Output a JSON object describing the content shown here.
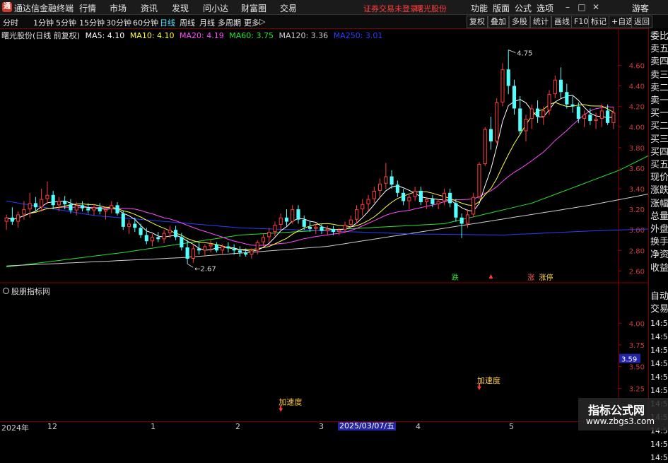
{
  "title_bar": {
    "app_name": "通达信金融终端",
    "menus": [
      "行情",
      "市场",
      "资讯",
      "发现",
      "问小达",
      "财富圈",
      "交易"
    ],
    "notice": "证券交易未登录",
    "stock_name": "曙光股份",
    "right_menus": [
      "功能",
      "版面",
      "公式",
      "选项"
    ],
    "guest": "游客",
    "win_min": "–",
    "win_max": "□",
    "win_close": "✕"
  },
  "toolbar": {
    "periods": [
      "分时",
      "1分钟",
      "5分钟",
      "15分钟",
      "30分钟",
      "60分钟",
      "日线",
      "周线",
      "月线",
      "多周期",
      "更多"
    ],
    "active_period": "日线",
    "more_arrow": "▷",
    "buttons": [
      "复权",
      "叠加",
      "多股",
      "统计",
      "画线",
      "F10",
      "标记",
      "+自选",
      "返回"
    ]
  },
  "chart_header": {
    "stock_label": "曙光股份(日线 前复权)",
    "ma": [
      {
        "label": "MA5: 4.10",
        "color": "#ffffff"
      },
      {
        "label": "MA10: 4.10",
        "color": "#ffff3a"
      },
      {
        "label": "MA20: 4.19",
        "color": "#ff4cff"
      },
      {
        "label": "MA60: 3.75",
        "color": "#29e22d"
      },
      {
        "label": "MA120: 3.36",
        "color": "#cfcfcf"
      },
      {
        "label": "MA250: 3.01",
        "color": "#2c3cff"
      }
    ]
  },
  "colors": {
    "up": "#ff3d3d",
    "down": "#54ffff",
    "ma5": "#ffffff",
    "ma10": "#ffff3a",
    "ma20": "#ff4cff",
    "ma60": "#29e22d",
    "ma120": "#cfcfcf",
    "ma250": "#2c3cff",
    "axis": "#8b0000",
    "grid": "#5a0000"
  },
  "annotations": {
    "high_label": "4.75",
    "low_label": "2.67",
    "signal_die": "跌",
    "signal_zhang": "涨",
    "signal_zhangting": "涨停"
  },
  "indicator": {
    "title": "股朋指标网",
    "signal_text": "加速度",
    "current_value_label": "3.59"
  },
  "right_panel": {
    "items": [
      "委比",
      "卖五",
      "卖四",
      "卖三",
      "卖二",
      "卖一",
      "买一",
      "买二",
      "买三",
      "买四",
      "买五",
      "现价",
      "涨跌",
      "涨幅",
      "总量",
      "外盘",
      "换手",
      "净资",
      "收益"
    ],
    "auto": "自动",
    "trade": "交易",
    "times": [
      "14:56",
      "14:56",
      "14:56",
      "14:56",
      "14:56",
      "14:56",
      "14:56",
      "14:56",
      "14:56",
      "14:56",
      "14:56"
    ]
  },
  "time_axis": {
    "labels": [
      "2024年",
      "12",
      "1",
      "2",
      "3",
      "2025/03/07/五",
      "4",
      "5"
    ]
  },
  "watermark": {
    "line1": "指标公式网",
    "line2": "www.zbgs3.com"
  },
  "chart_data": [
    {
      "type": "candlestick",
      "title": "曙光股份(日线 前复权)",
      "ylim": [
        2.5,
        4.85
      ],
      "y_ticks": [
        2.6,
        2.8,
        3.0,
        3.2,
        3.4,
        3.6,
        3.8,
        4.0,
        4.2,
        4.4,
        4.6
      ],
      "candles": [
        {
          "o": 3.08,
          "h": 3.15,
          "l": 3.0,
          "c": 3.12
        },
        {
          "o": 3.12,
          "h": 3.22,
          "l": 3.05,
          "c": 3.08
        },
        {
          "o": 3.08,
          "h": 3.18,
          "l": 3.02,
          "c": 3.15
        },
        {
          "o": 3.15,
          "h": 3.28,
          "l": 3.1,
          "c": 3.2
        },
        {
          "o": 3.2,
          "h": 3.36,
          "l": 3.12,
          "c": 3.26
        },
        {
          "o": 3.26,
          "h": 3.32,
          "l": 3.18,
          "c": 3.22
        },
        {
          "o": 3.22,
          "h": 3.4,
          "l": 3.18,
          "c": 3.3
        },
        {
          "o": 3.3,
          "h": 3.47,
          "l": 3.25,
          "c": 3.34
        },
        {
          "o": 3.34,
          "h": 3.38,
          "l": 3.2,
          "c": 3.24
        },
        {
          "o": 3.24,
          "h": 3.32,
          "l": 3.18,
          "c": 3.28
        },
        {
          "o": 3.28,
          "h": 3.33,
          "l": 3.2,
          "c": 3.25
        },
        {
          "o": 3.25,
          "h": 3.3,
          "l": 3.16,
          "c": 3.19
        },
        {
          "o": 3.19,
          "h": 3.27,
          "l": 3.14,
          "c": 3.24
        },
        {
          "o": 3.24,
          "h": 3.28,
          "l": 3.18,
          "c": 3.21
        },
        {
          "o": 3.21,
          "h": 3.26,
          "l": 3.16,
          "c": 3.19
        },
        {
          "o": 3.19,
          "h": 3.25,
          "l": 3.14,
          "c": 3.22
        },
        {
          "o": 3.22,
          "h": 3.26,
          "l": 3.15,
          "c": 3.18
        },
        {
          "o": 3.18,
          "h": 3.22,
          "l": 3.1,
          "c": 3.2
        },
        {
          "o": 3.2,
          "h": 3.28,
          "l": 3.16,
          "c": 3.24
        },
        {
          "o": 3.24,
          "h": 3.27,
          "l": 3.14,
          "c": 3.16
        },
        {
          "o": 3.16,
          "h": 3.19,
          "l": 3.0,
          "c": 3.03
        },
        {
          "o": 3.03,
          "h": 3.1,
          "l": 2.96,
          "c": 3.06
        },
        {
          "o": 3.06,
          "h": 3.12,
          "l": 2.98,
          "c": 3.02
        },
        {
          "o": 3.02,
          "h": 3.06,
          "l": 2.92,
          "c": 2.95
        },
        {
          "o": 2.95,
          "h": 3.02,
          "l": 2.86,
          "c": 2.89
        },
        {
          "o": 2.89,
          "h": 2.96,
          "l": 2.84,
          "c": 2.93
        },
        {
          "o": 2.93,
          "h": 2.98,
          "l": 2.88,
          "c": 2.91
        },
        {
          "o": 2.91,
          "h": 3.0,
          "l": 2.87,
          "c": 2.97
        },
        {
          "o": 2.97,
          "h": 3.04,
          "l": 2.92,
          "c": 3.0
        },
        {
          "o": 3.0,
          "h": 3.04,
          "l": 2.9,
          "c": 2.93
        },
        {
          "o": 2.93,
          "h": 2.97,
          "l": 2.8,
          "c": 2.83
        },
        {
          "o": 2.83,
          "h": 2.9,
          "l": 2.67,
          "c": 2.72
        },
        {
          "o": 2.72,
          "h": 2.86,
          "l": 2.68,
          "c": 2.82
        },
        {
          "o": 2.82,
          "h": 2.88,
          "l": 2.76,
          "c": 2.8
        },
        {
          "o": 2.8,
          "h": 2.86,
          "l": 2.74,
          "c": 2.84
        },
        {
          "o": 2.84,
          "h": 2.9,
          "l": 2.78,
          "c": 2.86
        },
        {
          "o": 2.86,
          "h": 2.88,
          "l": 2.78,
          "c": 2.8
        },
        {
          "o": 2.8,
          "h": 2.86,
          "l": 2.76,
          "c": 2.84
        },
        {
          "o": 2.84,
          "h": 2.88,
          "l": 2.78,
          "c": 2.82
        },
        {
          "o": 2.82,
          "h": 2.86,
          "l": 2.76,
          "c": 2.8
        },
        {
          "o": 2.8,
          "h": 2.84,
          "l": 2.74,
          "c": 2.78
        },
        {
          "o": 2.78,
          "h": 2.82,
          "l": 2.74,
          "c": 2.76
        },
        {
          "o": 2.76,
          "h": 2.82,
          "l": 2.72,
          "c": 2.8
        },
        {
          "o": 2.8,
          "h": 2.9,
          "l": 2.76,
          "c": 2.88
        },
        {
          "o": 2.88,
          "h": 2.96,
          "l": 2.84,
          "c": 2.93
        },
        {
          "o": 2.93,
          "h": 3.02,
          "l": 2.88,
          "c": 2.98
        },
        {
          "o": 2.98,
          "h": 3.08,
          "l": 2.94,
          "c": 3.05
        },
        {
          "o": 3.05,
          "h": 3.16,
          "l": 3.0,
          "c": 3.12
        },
        {
          "o": 3.12,
          "h": 3.2,
          "l": 3.04,
          "c": 3.08
        },
        {
          "o": 3.08,
          "h": 3.24,
          "l": 3.06,
          "c": 3.2
        },
        {
          "o": 3.2,
          "h": 3.24,
          "l": 3.06,
          "c": 3.1
        },
        {
          "o": 3.1,
          "h": 3.14,
          "l": 3.0,
          "c": 3.03
        },
        {
          "o": 3.03,
          "h": 3.08,
          "l": 2.98,
          "c": 3.01
        },
        {
          "o": 3.01,
          "h": 3.06,
          "l": 2.96,
          "c": 3.03
        },
        {
          "o": 3.03,
          "h": 3.06,
          "l": 2.96,
          "c": 2.99
        },
        {
          "o": 2.99,
          "h": 3.04,
          "l": 2.95,
          "c": 3.01
        },
        {
          "o": 3.01,
          "h": 3.04,
          "l": 2.95,
          "c": 2.98
        },
        {
          "o": 2.98,
          "h": 3.02,
          "l": 2.95,
          "c": 3.0
        },
        {
          "o": 3.0,
          "h": 3.08,
          "l": 2.97,
          "c": 3.05
        },
        {
          "o": 3.05,
          "h": 3.14,
          "l": 3.02,
          "c": 3.1
        },
        {
          "o": 3.1,
          "h": 3.24,
          "l": 3.06,
          "c": 3.2
        },
        {
          "o": 3.2,
          "h": 3.3,
          "l": 3.14,
          "c": 3.25
        },
        {
          "o": 3.25,
          "h": 3.34,
          "l": 3.18,
          "c": 3.3
        },
        {
          "o": 3.3,
          "h": 3.42,
          "l": 3.26,
          "c": 3.38
        },
        {
          "o": 3.38,
          "h": 3.5,
          "l": 3.32,
          "c": 3.45
        },
        {
          "o": 3.45,
          "h": 3.65,
          "l": 3.4,
          "c": 3.52
        },
        {
          "o": 3.52,
          "h": 3.58,
          "l": 3.4,
          "c": 3.44
        },
        {
          "o": 3.44,
          "h": 3.48,
          "l": 3.32,
          "c": 3.36
        },
        {
          "o": 3.36,
          "h": 3.4,
          "l": 3.24,
          "c": 3.28
        },
        {
          "o": 3.28,
          "h": 3.34,
          "l": 3.2,
          "c": 3.32
        },
        {
          "o": 3.32,
          "h": 3.42,
          "l": 3.28,
          "c": 3.38
        },
        {
          "o": 3.38,
          "h": 3.42,
          "l": 3.24,
          "c": 3.27
        },
        {
          "o": 3.27,
          "h": 3.32,
          "l": 3.2,
          "c": 3.3
        },
        {
          "o": 3.3,
          "h": 3.34,
          "l": 3.22,
          "c": 3.25
        },
        {
          "o": 3.25,
          "h": 3.3,
          "l": 3.2,
          "c": 3.28
        },
        {
          "o": 3.28,
          "h": 3.4,
          "l": 3.24,
          "c": 3.36
        },
        {
          "o": 3.36,
          "h": 3.4,
          "l": 3.22,
          "c": 3.26
        },
        {
          "o": 3.26,
          "h": 3.3,
          "l": 3.08,
          "c": 3.12
        },
        {
          "o": 3.12,
          "h": 3.16,
          "l": 2.92,
          "c": 3.06
        },
        {
          "o": 3.06,
          "h": 3.2,
          "l": 3.02,
          "c": 3.15
        },
        {
          "o": 3.15,
          "h": 3.36,
          "l": 3.12,
          "c": 3.32
        },
        {
          "o": 3.32,
          "h": 3.66,
          "l": 3.3,
          "c": 3.64
        },
        {
          "o": 3.64,
          "h": 4.0,
          "l": 3.62,
          "c": 3.98
        },
        {
          "o": 3.98,
          "h": 4.1,
          "l": 3.78,
          "c": 3.86
        },
        {
          "o": 3.86,
          "h": 4.28,
          "l": 3.84,
          "c": 4.24
        },
        {
          "o": 4.24,
          "h": 4.62,
          "l": 4.2,
          "c": 4.56
        },
        {
          "o": 4.56,
          "h": 4.75,
          "l": 4.32,
          "c": 4.4
        },
        {
          "o": 4.4,
          "h": 4.46,
          "l": 4.12,
          "c": 4.18
        },
        {
          "o": 4.18,
          "h": 4.3,
          "l": 3.92,
          "c": 3.96
        },
        {
          "o": 3.96,
          "h": 4.12,
          "l": 3.86,
          "c": 4.08
        },
        {
          "o": 4.08,
          "h": 4.22,
          "l": 3.98,
          "c": 4.18
        },
        {
          "o": 4.18,
          "h": 4.26,
          "l": 4.04,
          "c": 4.1
        },
        {
          "o": 4.1,
          "h": 4.2,
          "l": 4.02,
          "c": 4.16
        },
        {
          "o": 4.16,
          "h": 4.36,
          "l": 4.12,
          "c": 4.32
        },
        {
          "o": 4.32,
          "h": 4.5,
          "l": 4.28,
          "c": 4.46
        },
        {
          "o": 4.46,
          "h": 4.58,
          "l": 4.28,
          "c": 4.34
        },
        {
          "o": 4.34,
          "h": 4.42,
          "l": 4.18,
          "c": 4.22
        },
        {
          "o": 4.22,
          "h": 4.3,
          "l": 4.14,
          "c": 4.2
        },
        {
          "o": 4.2,
          "h": 4.24,
          "l": 4.04,
          "c": 4.08
        },
        {
          "o": 4.08,
          "h": 4.16,
          "l": 4.0,
          "c": 4.12
        },
        {
          "o": 4.12,
          "h": 4.18,
          "l": 4.02,
          "c": 4.06
        },
        {
          "o": 4.06,
          "h": 4.14,
          "l": 3.98,
          "c": 4.08
        },
        {
          "o": 4.08,
          "h": 4.22,
          "l": 4.0,
          "c": 4.16
        },
        {
          "o": 4.16,
          "h": 4.22,
          "l": 4.02,
          "c": 4.04
        },
        {
          "o": 4.04,
          "h": 4.2,
          "l": 3.98,
          "c": 4.14
        }
      ],
      "ma_series": [
        {
          "name": "MA60",
          "color": "#29e22d",
          "values": [
            [
              0,
              2.64
            ],
            [
              20,
              2.78
            ],
            [
              40,
              2.95
            ],
            [
              55,
              3.0
            ],
            [
              75,
              3.06
            ],
            [
              90,
              3.26
            ],
            [
              105,
              3.58
            ],
            [
              111,
              3.75
            ]
          ]
        },
        {
          "name": "MA120",
          "color": "#cfcfcf",
          "values": [
            [
              0,
              2.65
            ],
            [
              30,
              2.73
            ],
            [
              55,
              2.84
            ],
            [
              80,
              3.06
            ],
            [
              100,
              3.24
            ],
            [
              111,
              3.36
            ]
          ]
        },
        {
          "name": "MA250",
          "color": "#2c3cff",
          "values": [
            [
              0,
              3.28
            ],
            [
              15,
              3.14
            ],
            [
              40,
              3.02
            ],
            [
              70,
              2.96
            ],
            [
              85,
              2.95
            ],
            [
              100,
              2.99
            ],
            [
              111,
              3.01
            ]
          ]
        }
      ],
      "high_marker": {
        "index": 86,
        "value": 4.75
      },
      "low_marker": {
        "index": 31,
        "value": 2.67
      }
    },
    {
      "type": "line",
      "title": "股朋指标网",
      "y_ticks": [
        3.0,
        3.25,
        3.5,
        3.75,
        4.0
      ],
      "ylim": [
        2.87,
        4.45
      ],
      "current_value": 3.59,
      "signals": [
        {
          "index": 47,
          "value": 2.98,
          "label": "加速度"
        },
        {
          "index": 81,
          "value": 3.23,
          "label": "加速度"
        }
      ]
    }
  ]
}
